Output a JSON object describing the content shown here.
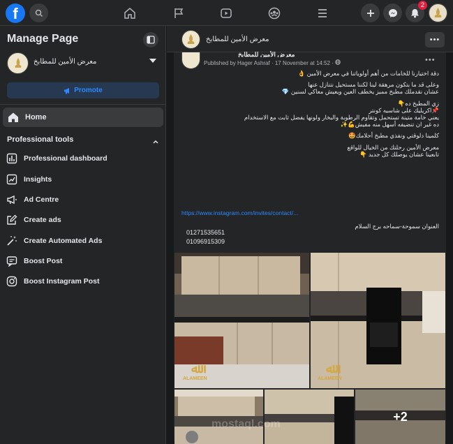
{
  "topbar": {
    "logo_letter": "f",
    "notification_count": "2",
    "icons": [
      "search-icon",
      "home-icon",
      "flag-icon",
      "video-icon",
      "groups-icon",
      "menu-icon",
      "plus-icon",
      "messenger-icon",
      "bell-icon"
    ]
  },
  "sidebar": {
    "title": "Manage Page",
    "page_name": "معرض الأمين للمطابخ",
    "promote_label": "Promote",
    "home_label": "Home",
    "section_title": "Professional tools",
    "tools": [
      {
        "label": "Professional dashboard",
        "icon": "dashboard-icon"
      },
      {
        "label": "Insights",
        "icon": "insights-icon"
      },
      {
        "label": "Ad Centre",
        "icon": "megaphone-icon"
      },
      {
        "label": "Create ads",
        "icon": "edit-icon"
      },
      {
        "label": "Create Automated Ads",
        "icon": "wand-icon"
      },
      {
        "label": "Boost Post",
        "icon": "boost-icon"
      },
      {
        "label": "Boost Instagram Post",
        "icon": "instagram-icon"
      }
    ]
  },
  "page_header": {
    "name": "معرض الأمين للمطابخ",
    "more_label": "•••"
  },
  "post": {
    "author": "معرض الأمين للمطابخ",
    "meta": "Published by Hager Ashraf · 17 November at 14:52 ·",
    "more_label": "•••",
    "lines": [
      "دقة اختيارنا للخامات من أهم أولوياتنا في معرض الأمين 👌",
      "وعلى قد ما بتكون مرهقة لينا لكننا مستحيل نتنازل عنها",
      "عشان نقدملك مطبخ مميز يخطف العين ويعيش معاكي لسنين 💎",
      "",
      "زي المطبخ ده👇",
      "📌اكريليك على شاسيه كونتر",
      "يعني خامة متينة تستحمل وتقاوم الرطوبة والبخار ولونها يفضل ثابت مع الاستخدام",
      "ده غير ان تنضيفه أسهل منه مفيش💪✨",
      "كلمينا دلوقتي ونفذي مطبخ أحلامك🤩",
      "",
      "معرض الأمين رحلتك من الخيال للواقع",
      "تابعينا عشان يوصلك كل جديد 👇"
    ],
    "link": "https://www.instagram.com/invites/contact/...",
    "address": "العنوان سموحة-سماحه برج السلام",
    "phones": [
      "01271535651",
      "01096915309"
    ],
    "more_photos": "+2",
    "watermark_brand": "ALAMEEN",
    "watermark_site": "mostaql.com"
  }
}
